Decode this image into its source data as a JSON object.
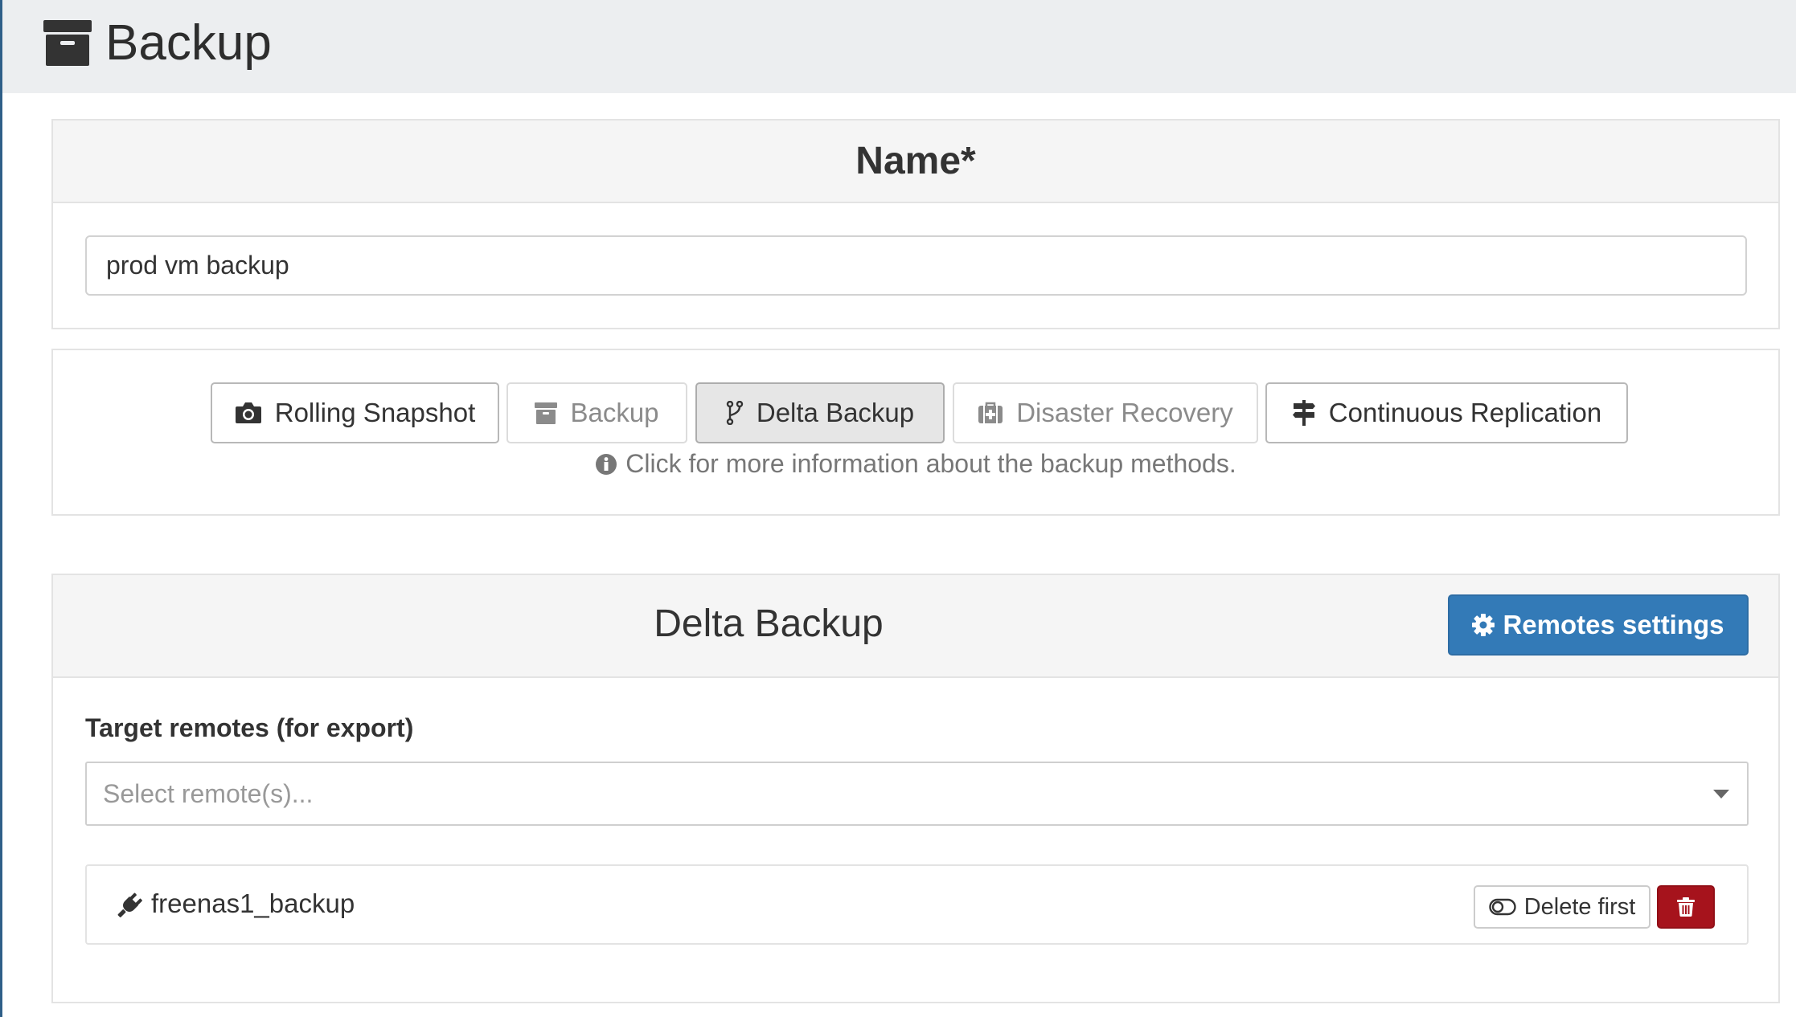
{
  "header": {
    "title": "Backup",
    "icon": "archive-icon"
  },
  "name_section": {
    "heading": "Name*",
    "value": "prod vm backup"
  },
  "modes": {
    "buttons": [
      {
        "label": "Rolling Snapshot",
        "icon": "camera-icon",
        "state": "normal"
      },
      {
        "label": "Backup",
        "icon": "archive-icon",
        "state": "disabled"
      },
      {
        "label": "Delta Backup",
        "icon": "code-fork-icon",
        "state": "active"
      },
      {
        "label": "Disaster Recovery",
        "icon": "medkit-icon",
        "state": "disabled"
      },
      {
        "label": "Continuous Replication",
        "icon": "signs-icon",
        "state": "normal"
      }
    ],
    "help_text": "Click for more information about the backup methods."
  },
  "delta_section": {
    "heading": "Delta Backup",
    "remotes_settings_label": "Remotes settings",
    "target_label": "Target remotes (for export)",
    "select_placeholder": "Select remote(s)...",
    "remote": {
      "name": "freenas1_backup",
      "delete_first_label": "Delete first"
    }
  },
  "colors": {
    "primary": "#337ab7",
    "danger": "#a6131c",
    "header_bg": "#eceef0",
    "panel_bg": "#f5f5f5"
  }
}
